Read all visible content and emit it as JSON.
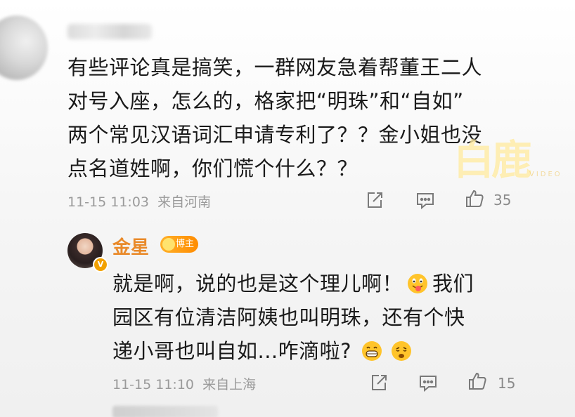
{
  "top_comment": {
    "lines": [
      "有些评论真是搞笑，一群网友急着帮董王二人",
      "对号入座，怎么的，格家把“明珠”和“自如”",
      "两个常见汉语词汇申请专利了？？金小姐也没",
      "点名道姓啊，你们慌个什么？？"
    ],
    "timestamp": "11-15 11:03",
    "location": "来自河南",
    "like_count": "35"
  },
  "reply": {
    "username": "金星",
    "badge_label": "博主",
    "line1_before": "就是啊，说的也是这个理儿啊！",
    "line1_after": "我们",
    "line2": "园区有位清洁阿姨也叫明珠，还有个快",
    "line3": "递小哥也叫自如...咋滴啦?",
    "timestamp": "11-15 11:10",
    "location": "来自上海",
    "like_count": "15"
  },
  "watermark": {
    "text": "白鹿",
    "sub": "VIDEO"
  },
  "colors": {
    "username_orange": "#e98a2a",
    "meta_gray": "#9a9a9a",
    "text_dark": "#1a1a1a"
  },
  "icons": [
    "share-icon",
    "comment-icon",
    "like-icon",
    "tongue-emoji-icon",
    "grin-emoji-icon",
    "tired-emoji-icon"
  ]
}
